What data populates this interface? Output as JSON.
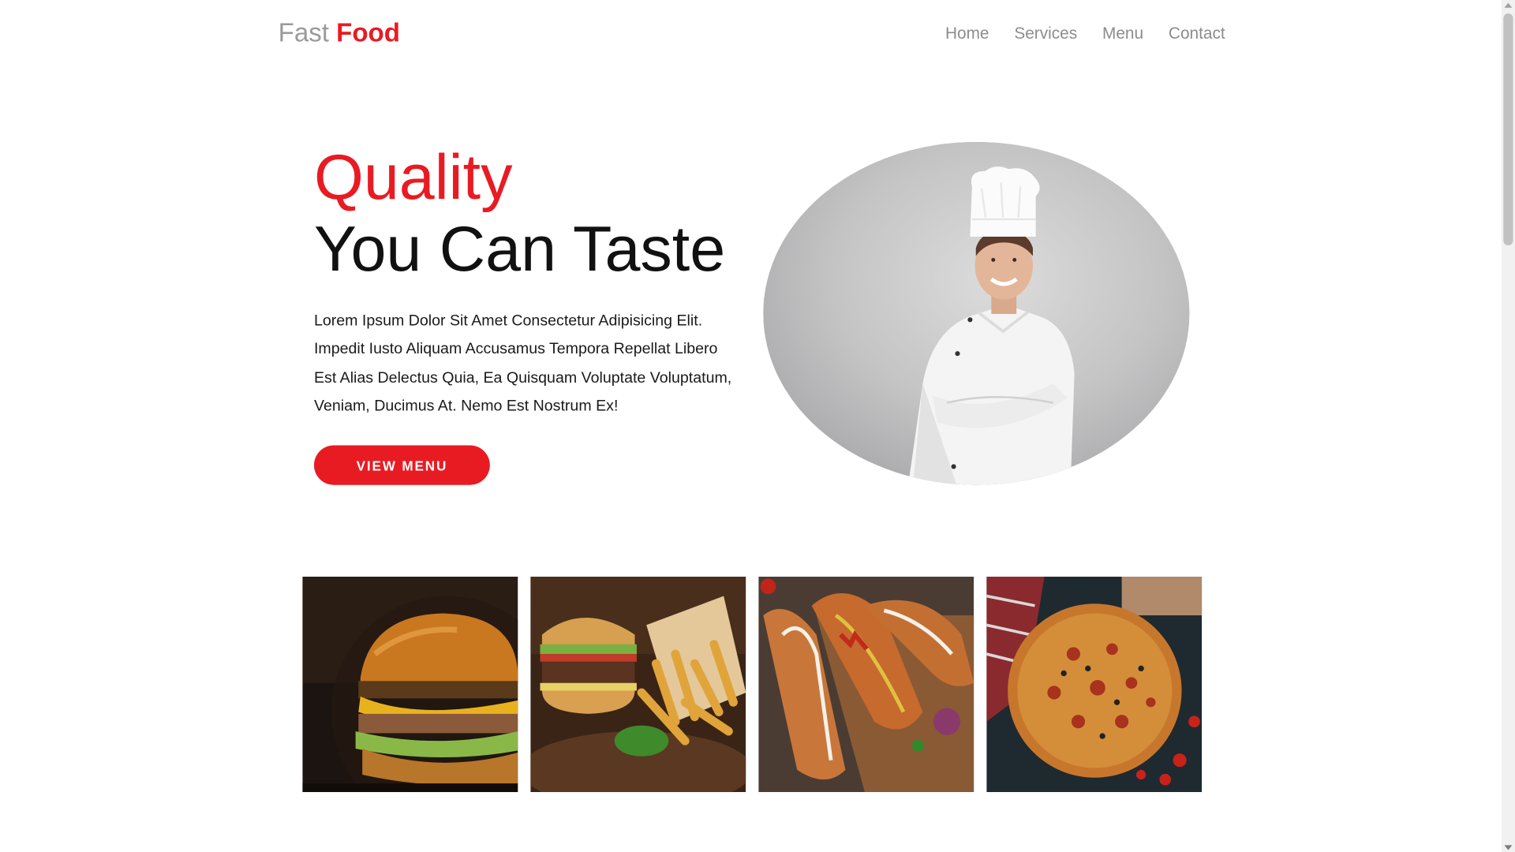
{
  "header": {
    "logo_light": "Fast",
    "logo_bold": "Food",
    "nav": [
      {
        "label": "Home"
      },
      {
        "label": "Services"
      },
      {
        "label": "Menu"
      },
      {
        "label": "Contact"
      }
    ]
  },
  "hero": {
    "title_accent": "Quality",
    "title_main": "You Can Taste",
    "description": "Lorem Ipsum Dolor Sit Amet Consectetur Adipisicing Elit. Impedit Iusto Aliquam Accusamus Tempora Repellat Libero Est Alias Delectus Quia, Ea Quisquam Voluptate Voluptatum, Veniam, Ducimus At. Nemo Est Nostrum Ex!",
    "cta_label": "VIEW MENU"
  },
  "gallery": [
    {
      "subject": "burger-photo"
    },
    {
      "subject": "burger-fries-photo"
    },
    {
      "subject": "hot-dogs-photo"
    },
    {
      "subject": "pizza-photo"
    }
  ],
  "colors": {
    "accent": "#e81b23",
    "muted_text": "#8c8c8c",
    "heading": "#111111"
  }
}
